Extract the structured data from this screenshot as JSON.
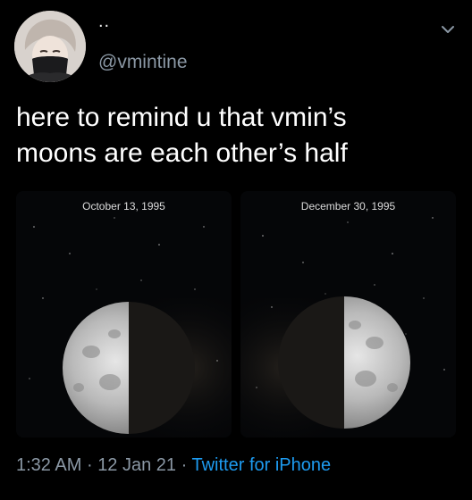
{
  "tweet": {
    "display_name": "..",
    "handle": "@vmintine",
    "text": "here to remind u that vmin’s\nmoons are each other’s half",
    "time": "1:32 AM",
    "separator": "·",
    "date": "12 Jan 21",
    "source": "Twitter for iPhone"
  },
  "media": {
    "left_label": "October 13, 1995",
    "right_label": "December 30, 1995"
  },
  "icons": {
    "more": "chevron-down-icon"
  },
  "colors": {
    "background": "#000000",
    "secondary_text": "#8b98a5",
    "link": "#1d9bf0"
  }
}
